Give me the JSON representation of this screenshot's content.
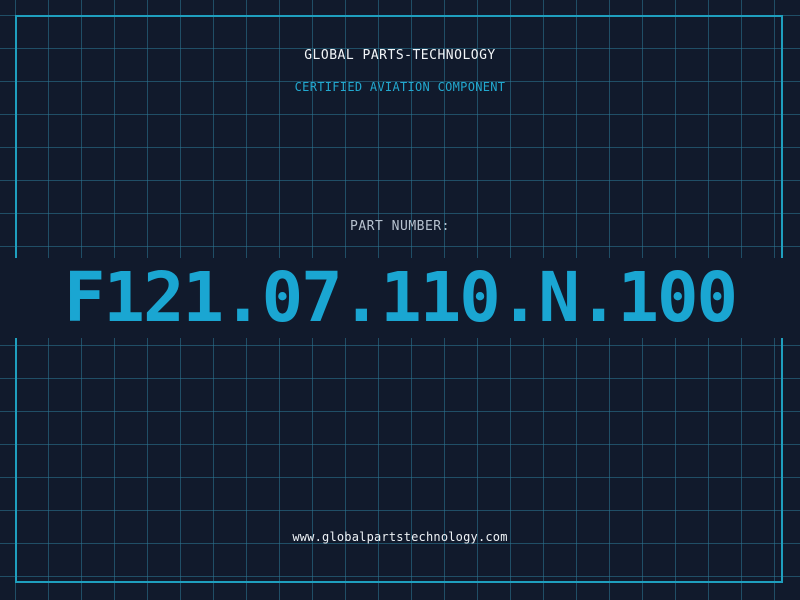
{
  "header": {
    "company": "GLOBAL PARTS-TECHNOLOGY",
    "tagline": "CERTIFIED AVIATION COMPONENT"
  },
  "part": {
    "label": "PART NUMBER:",
    "number": "F121.07.110.N.100"
  },
  "footer": {
    "website": "www.globalpartstechnology.com"
  },
  "colors": {
    "background": "#111a2c",
    "grid": "#2c7896",
    "frame": "#1f9fbe",
    "accent": "#1aa6d2",
    "text": "#f2f5f8",
    "muted": "#b7c2cf"
  }
}
